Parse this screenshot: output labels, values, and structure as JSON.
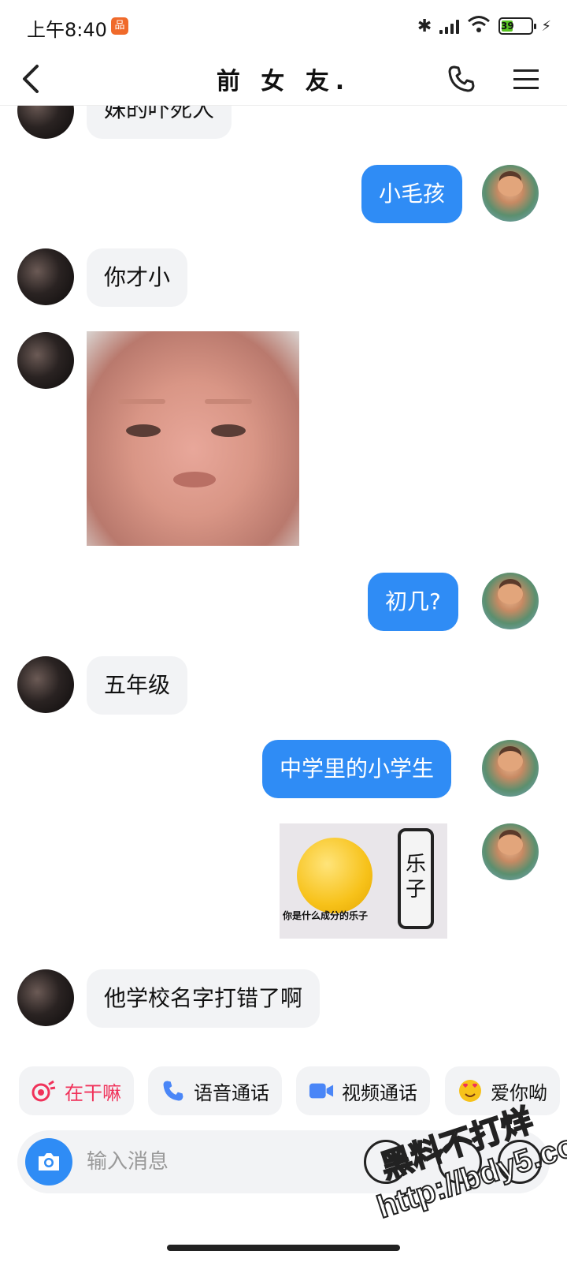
{
  "status_bar": {
    "time": "上午8:40",
    "app_badge": "品",
    "battery_level": "39"
  },
  "header": {
    "title": "前 女 友."
  },
  "messages": [
    {
      "sender": "them",
      "type": "text",
      "text": "妹的吓死人"
    },
    {
      "sender": "me",
      "type": "text",
      "text": "小毛孩"
    },
    {
      "sender": "them",
      "type": "text",
      "text": "你才小"
    },
    {
      "sender": "them",
      "type": "sticker",
      "sticker": "old-face-sticker"
    },
    {
      "sender": "me",
      "type": "text",
      "text": "初几?"
    },
    {
      "sender": "them",
      "type": "text",
      "text": "五年级"
    },
    {
      "sender": "me",
      "type": "text",
      "text": "中学里的小学生"
    },
    {
      "sender": "me",
      "type": "sticker",
      "sticker": "thinking-emoji-sticker",
      "sticker_text": "乐子",
      "caption": "你是什么成分的乐子"
    },
    {
      "sender": "them",
      "type": "text",
      "text": "他学校名字打错了啊"
    }
  ],
  "quick_actions": [
    {
      "label": "在干嘛",
      "icon": "wave-icon",
      "color": "#f0325a"
    },
    {
      "label": "语音通话",
      "icon": "phone-icon",
      "color": "#111111"
    },
    {
      "label": "视频通话",
      "icon": "video-icon",
      "color": "#111111"
    },
    {
      "label": "爱你呦",
      "icon": "heart-eyes-icon",
      "color": "#111111"
    }
  ],
  "input": {
    "placeholder": "输入消息"
  },
  "watermark": {
    "line1": "黑料不打烊",
    "line2": "http://bdy5.co"
  },
  "colors": {
    "accent": "#2f8cf5",
    "bubble_in": "#f2f3f5",
    "quick_pink": "#f0325a"
  }
}
